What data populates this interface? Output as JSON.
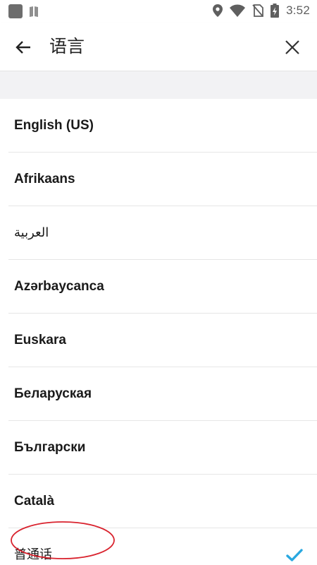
{
  "status_bar": {
    "time": "3:52",
    "icons": [
      "app-square-icon",
      "book-icon",
      "location-icon",
      "wifi-icon",
      "no-sim-icon",
      "battery-charging-icon"
    ]
  },
  "toolbar": {
    "title": "语言",
    "back_icon": "arrow-left-icon",
    "close_icon": "close-icon"
  },
  "languages": [
    {
      "label": "English (US)",
      "selected": false
    },
    {
      "label": "Afrikaans",
      "selected": false
    },
    {
      "label": "العربية",
      "selected": false
    },
    {
      "label": "Azərbaycanca",
      "selected": false
    },
    {
      "label": "Euskara",
      "selected": false
    },
    {
      "label": "Беларуская",
      "selected": false
    },
    {
      "label": "Български",
      "selected": false
    },
    {
      "label": "Català",
      "selected": false
    },
    {
      "label": "普通话",
      "selected": true
    }
  ],
  "colors": {
    "accent_check": "#29a8e0",
    "annotation": "#d9232e",
    "divider": "#e6e6e6",
    "band": "#f2f2f4"
  }
}
